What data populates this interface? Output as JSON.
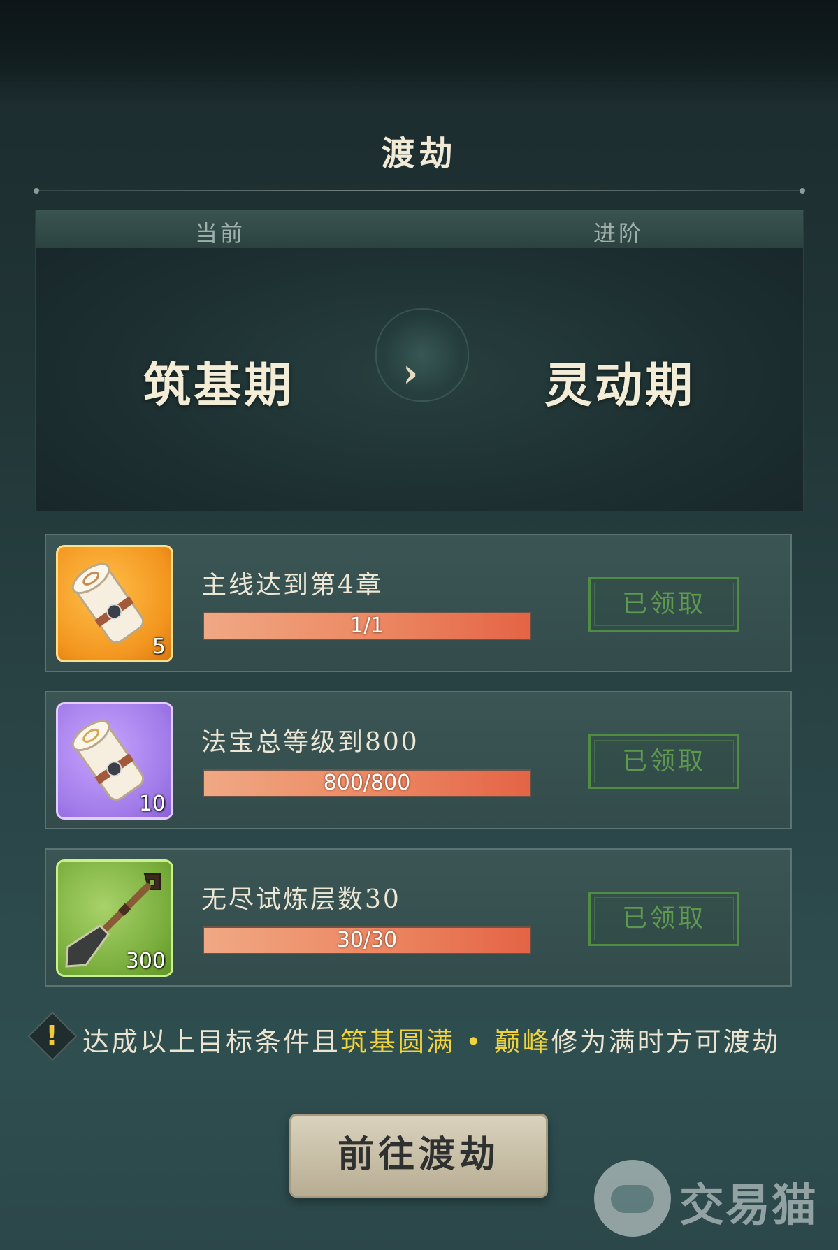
{
  "header": {
    "title": "渡劫"
  },
  "stage": {
    "current_label": "当前",
    "next_label": "进阶",
    "current_stage": "筑基期",
    "next_stage": "灵动期",
    "arrow": "›"
  },
  "tasks": [
    {
      "title": "主线达到第4章",
      "progress_text": "1/1",
      "progress_fraction": 1.0,
      "reward_qty": "5",
      "reward_icon": "scroll-icon",
      "rarity_color": "#f2951e",
      "button_label": "已领取"
    },
    {
      "title": "法宝总等级到800",
      "progress_text": "800/800",
      "progress_fraction": 1.0,
      "reward_qty": "10",
      "reward_icon": "scroll-icon",
      "rarity_color": "#a07ae8",
      "button_label": "已领取"
    },
    {
      "title": "无尽试炼层数30",
      "progress_text": "30/30",
      "progress_fraction": 1.0,
      "reward_qty": "300",
      "reward_icon": "shovel-icon",
      "rarity_color": "#77ac3a",
      "button_label": "已领取"
    }
  ],
  "notice": {
    "icon": "!",
    "text_before": "达成以上目标条件且",
    "highlight_1": "筑基圆满",
    "separator": " • ",
    "highlight_2": "巅峰",
    "text_after": "修为满时方可渡劫",
    "highlight_color": "#f0d23a"
  },
  "go_button": {
    "label": "前往渡劫"
  },
  "watermark": {
    "text": "交易猫"
  }
}
